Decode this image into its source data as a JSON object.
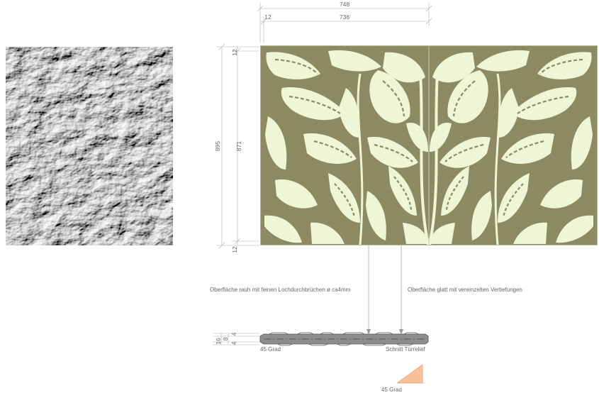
{
  "drawing": {
    "dimensions": {
      "overall_width": "748",
      "inner_width": "736",
      "edge_offset": "12",
      "overall_height": "895",
      "inner_height": "871",
      "top_margin": "12",
      "bottom_margin": "12",
      "section_total": "16",
      "section_core": "8",
      "section_top": "4",
      "section_bottom": "4"
    },
    "annotations": {
      "surface_rough": "Oberfläche rauh mit feinen Lochdurchbrüchen ø ca4mm",
      "surface_smooth": "Oberfläche glatt mit vereinzelten Vertiefungen",
      "angle_left": "45 Grad",
      "section_title": "Schnitt Türrelief",
      "angle_detail": "45 Grad"
    },
    "colors": {
      "panel_background": "#eef6d6",
      "panel_pattern": "#8c8a62",
      "relief_gray": "#9a9a9a",
      "detail_fill": "#f6c29a",
      "dimension_line": "#b0b0b0"
    }
  }
}
